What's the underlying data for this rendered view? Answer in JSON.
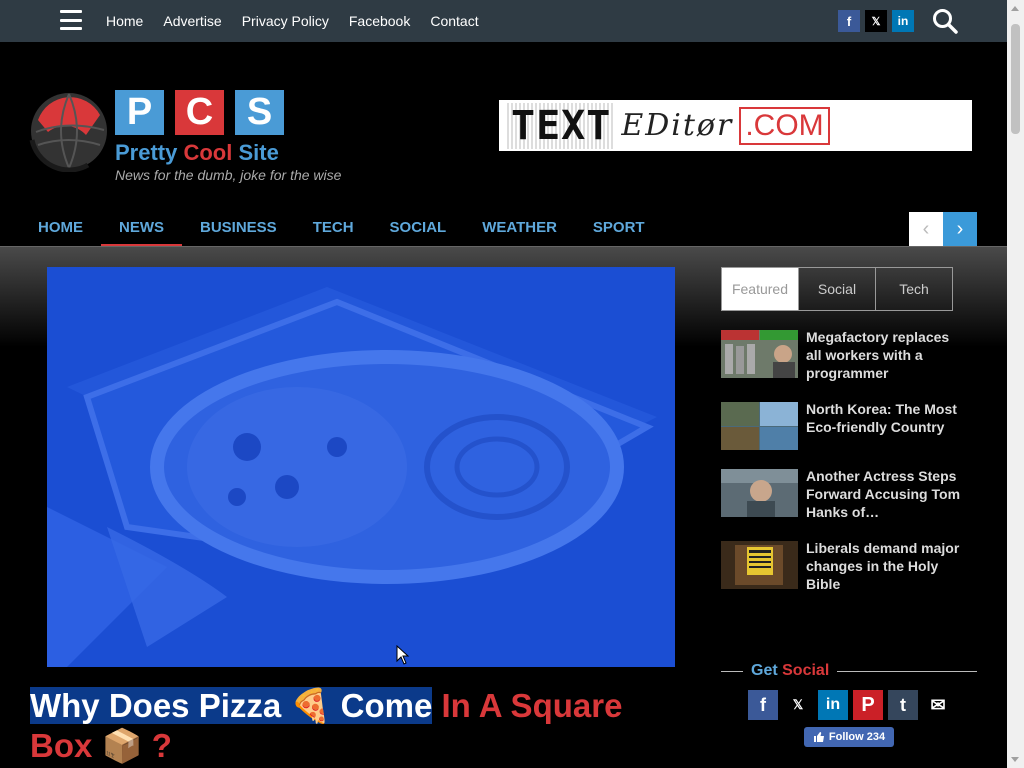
{
  "topbar": {
    "menu_icon": "hamburger-menu-icon",
    "links": [
      "Home",
      "Advertise",
      "Privacy Policy",
      "Facebook",
      "Contact"
    ],
    "social": [
      {
        "name": "facebook",
        "glyph": "f"
      },
      {
        "name": "x",
        "glyph": "𝕏"
      },
      {
        "name": "linkedin",
        "glyph": "in"
      }
    ],
    "search_icon": "search-icon"
  },
  "logo": {
    "letters": [
      "P",
      "C",
      "S"
    ],
    "name_start": "Pretty ",
    "name_mid": "Cool",
    "name_end": " Site",
    "tagline": "News for the dumb, joke for the wise"
  },
  "ad": {
    "part1": "TEXT",
    "part2": "EDitør",
    "part3": ".COM"
  },
  "nav": {
    "items": [
      "HOME",
      "NEWS",
      "BUSINESS",
      "TECH",
      "SOCIAL",
      "WEATHER",
      "SPORT"
    ],
    "active": "NEWS",
    "prev": "‹",
    "next": "›"
  },
  "article": {
    "title_highlight": "Why Does Pizza 🍕 Come",
    "title_rest": " In A Square Box 📦 ?"
  },
  "sidebar": {
    "tabs": [
      "Featured",
      "Social",
      "Tech"
    ],
    "active_tab": "Featured",
    "items": [
      {
        "title": "Megafactory replaces all workers with a programmer"
      },
      {
        "title": "North Korea: The Most Eco-friendly Country"
      },
      {
        "title": "Another Actress Steps Forward Accusing Tom Hanks of…"
      },
      {
        "title": "Liberals demand major changes in the Holy Bible"
      }
    ],
    "get_social_label_a": "Get ",
    "get_social_label_b": "Social",
    "social_buttons": [
      {
        "name": "facebook",
        "glyph": "f"
      },
      {
        "name": "x",
        "glyph": "𝕏"
      },
      {
        "name": "linkedin",
        "glyph": "in"
      },
      {
        "name": "pinterest",
        "glyph": "P"
      },
      {
        "name": "tumblr",
        "glyph": "t"
      },
      {
        "name": "email",
        "glyph": "✉"
      }
    ],
    "follow_label": "Follow 234"
  },
  "colors": {
    "accent_blue": "#5fa8db",
    "accent_red": "#d9383a",
    "topbar": "#2f3b44"
  }
}
